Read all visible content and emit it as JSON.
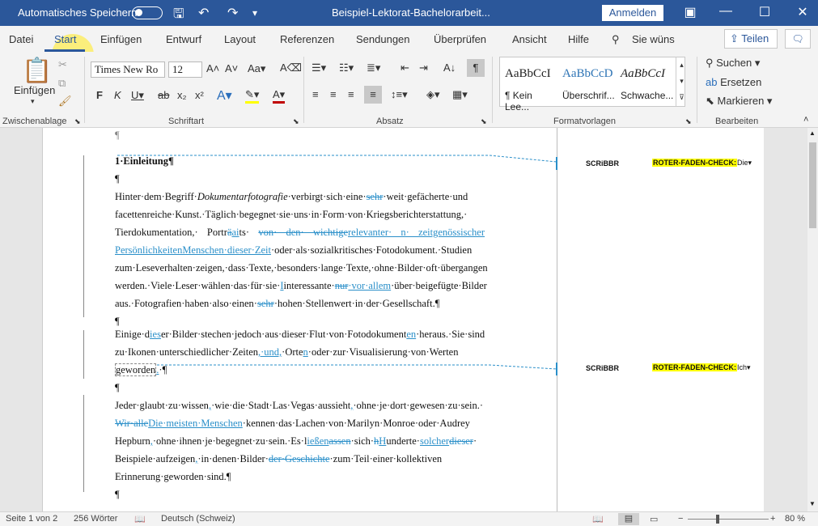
{
  "titlebar": {
    "autosave_label": "Automatisches Speichern",
    "doc_title": "Beispiel-Lektorat-Bachelorarbeit...",
    "login_label": "Anmelden"
  },
  "tabs": [
    "Datei",
    "Start",
    "Einfügen",
    "Entwurf",
    "Layout",
    "Referenzen",
    "Sendungen",
    "Überprüfen",
    "Ansicht",
    "Hilfe"
  ],
  "tell_me": "Sie wüns",
  "share_label": "Teilen",
  "ribbon": {
    "paste_label": "Einfügen",
    "font_name": "Times New Ro",
    "font_size": "12",
    "group_clipboard": "Zwischenablage",
    "group_font": "Schriftart",
    "group_paragraph": "Absatz",
    "group_styles": "Formatvorlagen",
    "group_editing": "Bearbeiten",
    "styles": [
      {
        "sample": "AaBbCcI",
        "name": "¶ Kein Lee..."
      },
      {
        "sample": "AaBbCcD",
        "name": "Überschrif..."
      },
      {
        "sample": "AaBbCcI",
        "name": "Schwache..."
      }
    ],
    "find_label": "Suchen",
    "replace_label": "Ersetzen",
    "select_label": "Markieren"
  },
  "comments": [
    {
      "author": "SCRiBBR",
      "mark": "ROTER-FADEN-CHECK:",
      "text": "Die"
    },
    {
      "author": "SCRiBBR",
      "mark": "ROTER-FADEN-CHECK:",
      "text": "Ich"
    }
  ],
  "status": {
    "page": "Seite 1 von 2",
    "words": "256 Wörter",
    "language": "Deutsch (Schweiz)",
    "zoom": "80 %"
  },
  "colors": {
    "accent": "#2b579a",
    "revision": "#2a8fc9",
    "highlight": "#ffff00"
  }
}
